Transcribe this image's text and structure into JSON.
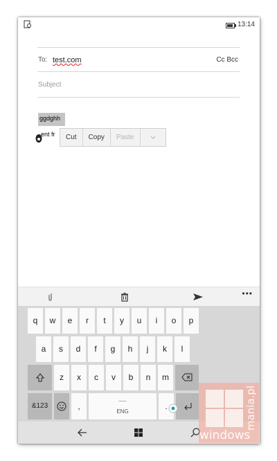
{
  "status": {
    "time": "13:14"
  },
  "compose": {
    "to_label": "To:",
    "to_value": "test.com",
    "cc_bcc": "Cc Bcc",
    "subject_placeholder": "Subject",
    "body_selected": "ggdghh",
    "body_line2": "ent fr"
  },
  "context_menu": {
    "cut": "Cut",
    "copy": "Copy",
    "paste": "Paste"
  },
  "toolbar": {
    "more": "•••"
  },
  "keyboard": {
    "row1": [
      "q",
      "w",
      "e",
      "r",
      "t",
      "y",
      "u",
      "i",
      "o",
      "p"
    ],
    "row2": [
      "a",
      "s",
      "d",
      "f",
      "g",
      "h",
      "j",
      "k",
      "l"
    ],
    "row3": [
      "z",
      "x",
      "c",
      "v",
      "b",
      "n",
      "m"
    ],
    "symbols_label": "&123",
    "comma": ",",
    "space_label": "ENG",
    "period": "."
  },
  "watermark": {
    "text": "windows",
    "vertical": "mania.pl"
  }
}
